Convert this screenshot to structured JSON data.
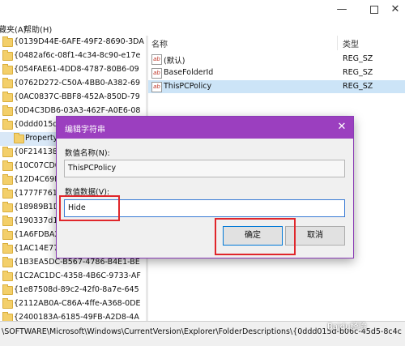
{
  "window": {
    "controls": {
      "minimize_icon": "minimize-icon",
      "maximize_icon": "maximize-icon",
      "close_glyph": "✕"
    }
  },
  "menu": {
    "favorites": "藏夹(A)",
    "help": "帮助(H)"
  },
  "tree": {
    "items": [
      "{0139D44E-6AFE-49F2-8690-3DA",
      "{0482af6c-08f1-4c34-8c90-e17e",
      "{054FAE61-4DD8-4787-80B6-09",
      "{0762D272-C50A-4BB0-A382-69",
      "{0AC0837C-BBF8-452A-850D-79",
      "{0D4C3DB6-03A3-462F-A0E6-08",
      "{0ddd015d-",
      "Property",
      "{0F214138-B",
      "{10C07CD0-",
      "{12D4C69E-2",
      "{1777F761-6",
      "{18989B1D-",
      "{190337d1-b",
      "{1A6FDBA2-",
      "{1AC14E77-0",
      "{1B3EA5DC-B567-4786-B4E1-BE",
      "{1C2AC1DC-4358-4B6C-9733-AF",
      "{1e87508d-89c2-42f0-8a7e-645",
      "{2112AB0A-C86A-4ffe-A368-0DE",
      "{2400183A-6185-49FB-A2D8-4A"
    ]
  },
  "list": {
    "col_name": "名称",
    "col_type": "类型",
    "rows": [
      {
        "name": "(默认)",
        "type": "REG_SZ",
        "icon_text": "ab"
      },
      {
        "name": "BaseFolderId",
        "type": "REG_SZ",
        "icon_text": "ab"
      },
      {
        "name": "ThisPCPolicy",
        "type": "REG_SZ",
        "icon_text": "ab"
      }
    ]
  },
  "status": {
    "path": "\\SOFTWARE\\Microsoft\\Windows\\CurrentVersion\\Explorer\\FolderDescriptions\\{0ddd015d-b06c-45d5-8c4c"
  },
  "watermark": "Baidu经验",
  "dialog": {
    "title": "编辑字符串",
    "close_glyph": "✕",
    "value_name_label": "数值名称(N):",
    "value_name": "ThisPCPolicy",
    "value_data_label": "数值数据(V):",
    "value_data": "Hide",
    "ok_label": "确定",
    "cancel_label": "取消"
  },
  "colors": {
    "dialog_title": "#9b3fbf",
    "highlight_box": "#e0262b",
    "selected_row": "#cce4f7"
  }
}
